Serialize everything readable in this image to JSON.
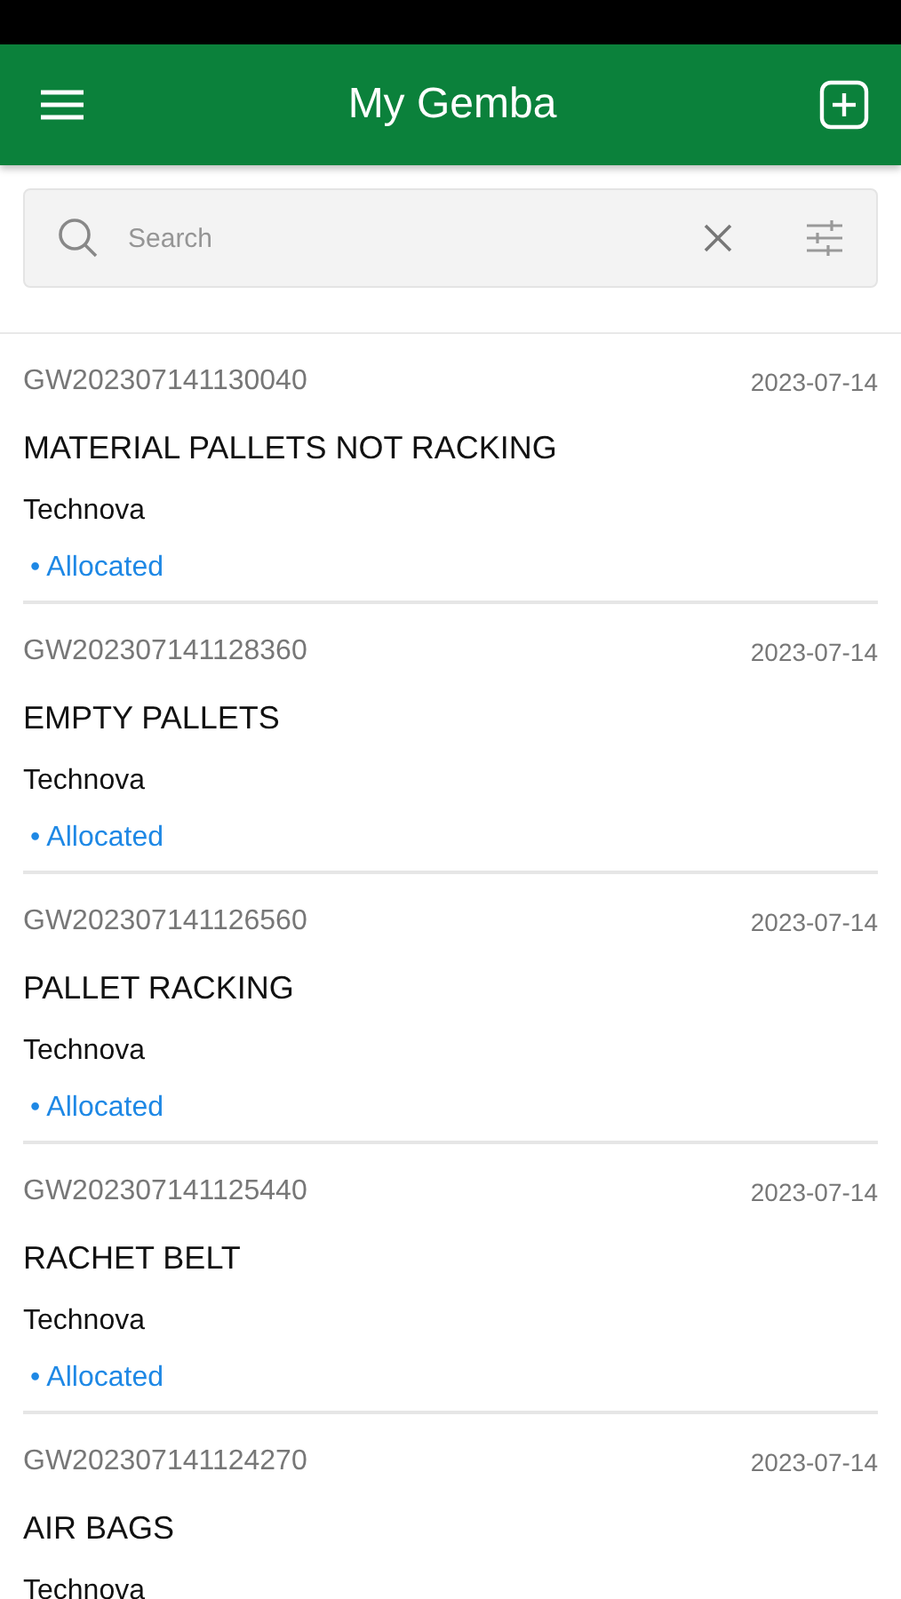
{
  "header": {
    "title": "My Gemba"
  },
  "search": {
    "placeholder": "Search"
  },
  "items": [
    {
      "id": "GW202307141130040",
      "date": "2023-07-14",
      "title": "MATERIAL PALLETS NOT RACKING",
      "company": "Technova",
      "status": "• Allocated"
    },
    {
      "id": "GW202307141128360",
      "date": "2023-07-14",
      "title": "EMPTY PALLETS",
      "company": "Technova",
      "status": "• Allocated"
    },
    {
      "id": "GW202307141126560",
      "date": "2023-07-14",
      "title": "PALLET RACKING",
      "company": "Technova",
      "status": "• Allocated"
    },
    {
      "id": "GW202307141125440",
      "date": "2023-07-14",
      "title": "RACHET BELT",
      "company": "Technova",
      "status": "• Allocated"
    },
    {
      "id": "GW202307141124270",
      "date": "2023-07-14",
      "title": "AIR BAGS",
      "company": "Technova"
    }
  ]
}
